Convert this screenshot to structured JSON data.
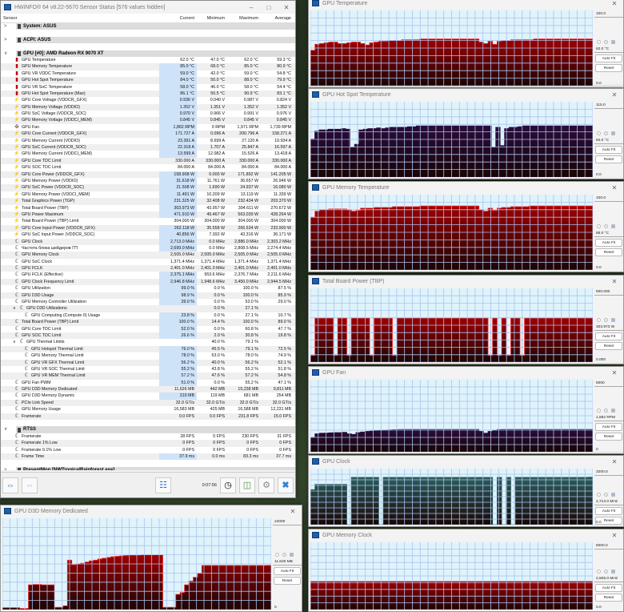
{
  "main": {
    "title": "HWiNFO® 64 v8.22-5670 Sensor Status [576 values hidden]",
    "columns": [
      "Sensor",
      "Current",
      "Minimum",
      "Maximum",
      "Average"
    ],
    "groups": {
      "system": "System: ASUS",
      "acpi": "ACPI: ASUS",
      "gpu": "GPU [#0]: AMD Radeon RX 9070 XT",
      "rtss": "RTSS",
      "presentmon": "PresentMon [NWTropicalRainforest.exe]"
    },
    "gpu_rows": [
      [
        "therm",
        "GPU Temperature",
        "62.0 °C",
        "47.0 °C",
        "62.0 °C",
        "59.3 °C",
        0,
        0
      ],
      [
        "therm",
        "GPU Memory Temperature",
        "85.0 °C",
        "68.0 °C",
        "85.0 °C",
        "80.9 °C",
        1,
        0
      ],
      [
        "therm",
        "GPU VR VDDC Temperature",
        "59.0 °C",
        "42.0 °C",
        "59.0 °C",
        "54.8 °C",
        1,
        0
      ],
      [
        "therm",
        "GPU Hot Spot Temperature",
        "84.0 °C",
        "50.0 °C",
        "88.0 °C",
        "79.9 °C",
        1,
        0
      ],
      [
        "therm",
        "GPU VR SoC Temperature",
        "58.0 °C",
        "46.0 °C",
        "58.0 °C",
        "54.4 °C",
        1,
        0
      ],
      [
        "therm",
        "GPU Hot Spot Temperature (Max)",
        "86.1 °C",
        "50.5 °C",
        "90.9 °C",
        "83.1 °C",
        1,
        0
      ],
      [
        "bolt",
        "GPU Core Voltage (VDDCR_GFX)",
        "0.936 V",
        "0.040 V",
        "0.987 V",
        "0.824 V",
        1,
        0
      ],
      [
        "bolt",
        "GPU Memory Voltage (VDDIO)",
        "1.352 V",
        "1.351 V",
        "1.352 V",
        "1.352 V",
        1,
        0
      ],
      [
        "bolt",
        "GPU SoC Voltage (VDDCR_SOC)",
        "0.970 V",
        "0.966 V",
        "0.991 V",
        "0.976 V",
        1,
        0
      ],
      [
        "bolt",
        "GPU Memory Voltage (VDDCI_MEM)",
        "0.845 V",
        "0.845 V",
        "0.845 V",
        "0.845 V",
        1,
        0
      ],
      [
        "fan",
        "GPU Fan",
        "1,862 RPM",
        "0 RPM",
        "1,971 RPM",
        "1,739 RPM",
        1,
        0
      ],
      [
        "bolt",
        "GPU Core Current (VDDCR_GFX)",
        "171.727 A",
        "0.096 A",
        "200.796 A",
        "158.271 A",
        1,
        0
      ],
      [
        "bolt",
        "GPU Memory Current (VDDIO)",
        "23.391 A",
        "8.699 A",
        "27.120 A",
        "19.934 A",
        1,
        0
      ],
      [
        "bolt",
        "GPU SoC Current (VDDCR_SOC)",
        "22.318 A",
        "1.707 A",
        "25.847 A",
        "16.597 A",
        1,
        0
      ],
      [
        "bolt",
        "GPU Memory Current (VDDCI_MEM)",
        "13.599 A",
        "12.082 A",
        "15.526 A",
        "13.418 A",
        1,
        0
      ],
      [
        "bolt",
        "GPU Core TDC Limit",
        "330.000 A",
        "330.000 A",
        "330.000 A",
        "330.000 A",
        0,
        0
      ],
      [
        "bolt",
        "GPU SOC TDC Limit",
        "84.000 A",
        "84.000 A",
        "84.000 A",
        "84.000 A",
        0,
        0
      ],
      [
        "bolt",
        "GPU Core Power (VDDCR_GFX)",
        "158.908 W",
        "0.000 W",
        "171.892 W",
        "141.205 W",
        1,
        0
      ],
      [
        "bolt",
        "GPU Memory Power (VDDIO)",
        "31.618 W",
        "11.761 W",
        "36.657 W",
        "26.946 W",
        1,
        0
      ],
      [
        "bolt",
        "GPU SoC Power (VDDCR_SOC)",
        "21.508 W",
        "1.690 W",
        "24.937 W",
        "16.080 W",
        1,
        0
      ],
      [
        "bolt",
        "GPU Memory Power (VDDCI_MEM)",
        "11.491 W",
        "10.209 W",
        "13.119 W",
        "11.339 W",
        1,
        0
      ],
      [
        "bolt",
        "Total Graphics Power (TGP)",
        "231.325 W",
        "32.408 W",
        "232.434 W",
        "203.370 W",
        1,
        0
      ],
      [
        "bolt",
        "Total Board Power (TBP)",
        "303.973 W",
        "43.957 W",
        "304.611 W",
        "270.672 W",
        1,
        0
      ],
      [
        "bolt",
        "GPU Power Maximum",
        "471.910 W",
        "49.467 W",
        "563.039 W",
        "428.264 W",
        1,
        0
      ],
      [
        "bolt",
        "Total Board Power (TBP) Limit",
        "304.000 W",
        "304.000 W",
        "304.000 W",
        "304.000 W",
        0,
        0
      ],
      [
        "bolt",
        "GPU Core Input Power (VDDCR_GFX)",
        "262.118 W",
        "35.558 W",
        "266.534 W",
        "233.900 W",
        1,
        0
      ],
      [
        "bolt",
        "GPU SoC Input Power (VDDCR_SOC)",
        "40.856 W",
        "7.392 W",
        "43.316 W",
        "36.171 W",
        1,
        0
      ],
      [
        "clk",
        "GPU Clock",
        "2,713.0 MHz",
        "0.0 MHz",
        "2,886.0 MHz",
        "2,303.2 MHz",
        1,
        0
      ],
      [
        "clk",
        "Частота блока шейдеров ГП",
        "2,699.0 MHz",
        "0.0 MHz",
        "2,808.5 MHz",
        "2,274.4 MHz",
        1,
        0
      ],
      [
        "clk",
        "GPU Memory Clock",
        "2,505.0 MHz",
        "2,505.0 MHz",
        "2,505.0 MHz",
        "2,505.0 MHz",
        0,
        0
      ],
      [
        "clk",
        "GPU SoC Clock",
        "1,371.4 MHz",
        "1,371.4 MHz",
        "1,371.4 MHz",
        "1,371.4 MHz",
        0,
        0
      ],
      [
        "clk",
        "GPU FCLK",
        "2,401.0 MHz",
        "2,401.0 MHz",
        "2,401.0 MHz",
        "2,401.0 MHz",
        0,
        0
      ],
      [
        "clk",
        "GPU FCLK (Effective)",
        "2,375.1 MHz",
        "953.6 MHz",
        "2,376.7 MHz",
        "2,211.6 MHz",
        1,
        0
      ],
      [
        "clk",
        "GPU Clock Frequency Limit",
        "2,946.8 MHz",
        "1,948.6 MHz",
        "3,450.0 MHz",
        "2,944.5 MHz",
        1,
        0
      ],
      [
        "clk",
        "GPU Utilization",
        "99.0 %",
        "0.0 %",
        "100.0 %",
        "87.5 %",
        1,
        0
      ],
      [
        "clk",
        "GPU D3D Usage",
        "98.9 %",
        "0.0 %",
        "100.0 %",
        "85.9 %",
        1,
        0
      ],
      [
        "clk",
        "GPU Memory Controller Utilization",
        "39.0 %",
        "0.0 %",
        "53.0 %",
        "29.0 %",
        1,
        0
      ],
      [
        "clk",
        "GPU D3D Utilizations",
        "",
        "0.0 %",
        "27.1 %",
        "",
        0,
        1
      ],
      [
        "clk",
        "GPU Computing (Compute 0) Usage",
        "23.8 %",
        "0.0 %",
        "27.1 %",
        "10.7 %",
        1,
        2
      ],
      [
        "clk",
        "Total Board Power (TBP) Limit",
        "100.0 %",
        "14.4 %",
        "100.0 %",
        "89.0 %",
        1,
        0
      ],
      [
        "clk",
        "GPU Core TDC Limit",
        "52.0 %",
        "0.0 %",
        "60.8 %",
        "47.7 %",
        1,
        0
      ],
      [
        "clk",
        "GPU SOC TDC Limit",
        "26.6 %",
        "2.0 %",
        "30.8 %",
        "19.8 %",
        1,
        0
      ],
      [
        "clk",
        "GPU Thermal Limits",
        "",
        "40.0 %",
        "79.1 %",
        "",
        0,
        1
      ],
      [
        "clk",
        "GPU Hotspot Thermal Limit",
        "76.0 %",
        "45.5 %",
        "79.1 %",
        "72.5 %",
        1,
        2
      ],
      [
        "clk",
        "GPU Memory Thermal Limit",
        "78.0 %",
        "63.0 %",
        "78.0 %",
        "74.9 %",
        1,
        2
      ],
      [
        "clk",
        "GPU VR GFX Thermal Limit",
        "56.2 %",
        "40.0 %",
        "56.2 %",
        "52.1 %",
        1,
        2
      ],
      [
        "clk",
        "GPU VR SOC Thermal Limit",
        "55.2 %",
        "43.8 %",
        "55.2 %",
        "51.8 %",
        1,
        2
      ],
      [
        "clk",
        "GPU VR MEM Thermal Limit",
        "57.2 %",
        "47.6 %",
        "57.2 %",
        "54.8 %",
        1,
        2
      ],
      [
        "clk",
        "GPU Fan PWM",
        "51.0 %",
        "0.0 %",
        "55.2 %",
        "47.1 %",
        1,
        0
      ],
      [
        "clk",
        "GPU D3D Memory Dedicated",
        "11,626 MB",
        "442 MB",
        "15,238 MB",
        "9,811 MB",
        0,
        0
      ],
      [
        "clk",
        "GPU D3D Memory Dynamic",
        "210 MB",
        "119 MB",
        "681 MB",
        "254 MB",
        1,
        0
      ],
      [
        "clk",
        "PCIe Link Speed",
        "32.0 GT/s",
        "32.0 GT/s",
        "32.0 GT/s",
        "32.0 GT/s",
        0,
        0
      ],
      [
        "clk",
        "GPU Memory Usage",
        "16,583 MB",
        "425 MB",
        "16,588 MB",
        "12,231 MB",
        0,
        0
      ],
      [
        "clk",
        "Framerate",
        "0.0 FPS",
        "0.0 FPS",
        "231.8 FPS",
        "15.0 FPS",
        0,
        0
      ]
    ],
    "rtss_rows": [
      [
        "clk",
        "Framerate",
        "28 FPS",
        "0 FPS",
        "230 FPS",
        "31 FPS",
        0,
        0
      ],
      [
        "clk",
        "Framerate 1% Low",
        "0 FPS",
        "0 FPS",
        "0 FPS",
        "0 FPS",
        0,
        0
      ],
      [
        "clk",
        "Framerate 0.1% Low",
        "0 FPS",
        "0 FPS",
        "0 FPS",
        "0 FPS",
        0,
        0
      ],
      [
        "clk",
        "Frame Time",
        "37.9 ms",
        "0.0 ms",
        "83.3 ms",
        "37.7 ms",
        1,
        0
      ]
    ],
    "timer": "0:07:56"
  },
  "graph_buttons": {
    "autofit": "Auto Fit",
    "reset": "Reset"
  },
  "graphs": [
    {
      "title": "GPU Temperature",
      "max": "100.0",
      "current": "62.0 °C",
      "min": "0.0",
      "scale": 100,
      "color": "#a00000",
      "values": [
        47,
        55,
        56,
        57,
        58,
        58,
        56,
        56,
        57,
        58,
        58,
        56,
        54,
        57,
        58,
        59,
        59,
        60,
        60,
        60,
        61,
        61,
        61,
        61,
        62,
        62,
        62,
        62,
        62,
        62,
        62,
        62,
        62,
        62,
        62,
        62,
        62,
        58,
        56,
        59,
        55,
        59,
        60,
        60,
        61,
        61,
        61,
        61,
        61,
        62,
        62,
        62,
        62,
        62,
        62,
        62,
        62,
        62,
        62,
        62,
        62,
        62
      ]
    },
    {
      "title": "GPU Hot Spot Temperature",
      "max": "115.0",
      "current": "84.0 °C",
      "min": "0.0",
      "scale": 115,
      "color": "#2a0c3a",
      "values": [
        58,
        70,
        72,
        72,
        73,
        73,
        73,
        74,
        73,
        45,
        50,
        72,
        73,
        74,
        74,
        75,
        74,
        75,
        76,
        76,
        76,
        76,
        77,
        77,
        78,
        78,
        78,
        78,
        78,
        78,
        78,
        78,
        78,
        78,
        78,
        78,
        78,
        78,
        78,
        78,
        78,
        45,
        76,
        48,
        74,
        76,
        76,
        77,
        78,
        78,
        78,
        78,
        78,
        78,
        78,
        78,
        78,
        78,
        78,
        78,
        78,
        78,
        78,
        78
      ]
    },
    {
      "title": "GPU Memory Temperature",
      "max": "100.0",
      "current": "85.0 °C",
      "min": "0.0",
      "scale": 100,
      "color": "#a00000",
      "values": [
        70,
        78,
        80,
        80,
        81,
        81,
        81,
        81,
        80,
        78,
        79,
        82,
        82,
        82,
        83,
        83,
        83,
        83,
        84,
        84,
        84,
        84,
        84,
        84,
        85,
        85,
        85,
        85,
        85,
        85,
        85,
        85,
        85,
        85,
        85,
        85,
        85,
        80,
        78,
        82,
        79,
        82,
        83,
        83,
        84,
        84,
        84,
        84,
        85,
        85,
        85,
        85,
        85,
        85,
        85,
        85,
        85,
        85,
        85,
        85,
        85,
        85
      ]
    },
    {
      "title": "Total Board Power (TBP)",
      "max": "500.000",
      "current": "303.973 W",
      "min": "0.000",
      "scale": 500,
      "color": "#a00000",
      "values": [
        45,
        300,
        300,
        300,
        300,
        45,
        300,
        300,
        45,
        300,
        300,
        300,
        300,
        45,
        300,
        300,
        300,
        300,
        45,
        300,
        300,
        300,
        300,
        300,
        300,
        300,
        300,
        300,
        300,
        300,
        300,
        300,
        300,
        300,
        300,
        300,
        300,
        300,
        300,
        45,
        300,
        45,
        300,
        45,
        300,
        300,
        45,
        300,
        300,
        300,
        300,
        300,
        300,
        300,
        300,
        300,
        300,
        300,
        300,
        300,
        300,
        300
      ]
    },
    {
      "title": "GPU Fan",
      "max": "6000",
      "current": "1,862 RPM",
      "min": "0",
      "scale": 6000,
      "color": "#2a0c3a",
      "values": [
        1200,
        1500,
        1550,
        1560,
        1580,
        1600,
        1600,
        1620,
        1500,
        1450,
        1600,
        1650,
        1700,
        1720,
        1750,
        1780,
        1800,
        1820,
        1840,
        1850,
        1860,
        1860,
        1860,
        1860,
        1860,
        1860,
        1860,
        1860,
        1860,
        1860,
        1860,
        1860,
        1860,
        1860,
        1860,
        1860,
        1860,
        1700,
        1550,
        1700,
        1800,
        1850,
        1860,
        1860,
        1860,
        1860,
        1860,
        1860,
        1860,
        1860,
        1860,
        1860,
        1860,
        1860,
        1860,
        1860,
        1860,
        1860,
        1860,
        1860,
        1860,
        1862
      ]
    },
    {
      "title": "GPU Clock",
      "max": "3200.0",
      "current": "2,713.0 MHz",
      "min": "0.0",
      "scale": 3200,
      "color": "#2c5e5c",
      "values": [
        2000,
        2300,
        2300,
        2300,
        2300,
        2300,
        2300,
        2300,
        0,
        2700,
        2700,
        2700,
        2700,
        2700,
        2700,
        0,
        2700,
        2700,
        2700,
        2700,
        2700,
        2700,
        2700,
        2700,
        2700,
        2700,
        2700,
        2700,
        2700,
        2700,
        2700,
        2700,
        2700,
        2700,
        2700,
        2700,
        2700,
        2700,
        2700,
        2700,
        0,
        2700,
        0,
        2700,
        0,
        2700,
        2700,
        2700,
        2700,
        2700,
        2700,
        2700,
        2700,
        2700,
        2700,
        2700,
        2700,
        2700,
        2700,
        2700,
        2700,
        2713
      ]
    },
    {
      "title": "GPU Memory Clock",
      "max": "6000.0",
      "current": "2,505.0 MHz",
      "min": "0.0",
      "scale": 6000,
      "color": "#a00000",
      "values": [
        2505,
        2505,
        2505,
        2505,
        2505,
        2505,
        2505,
        2505,
        2505,
        2505
      ]
    },
    {
      "title": "GPU D3D Memory Dedicated",
      "max": "24000",
      "current": "11,626 MB",
      "min": "0",
      "scale": 24000,
      "color": "#a00000",
      "values": [
        500,
        500,
        500,
        500,
        300,
        300,
        6500,
        6600,
        6600,
        6500,
        6500,
        6500,
        600,
        600,
        1000,
        13000,
        11800,
        12000,
        12200,
        12500,
        12800,
        13000,
        13300,
        13500,
        13700,
        13900,
        14000,
        14100,
        14200,
        14300,
        14300,
        14300,
        14400,
        14400,
        14400,
        14400,
        14400,
        600,
        600,
        600,
        4000,
        4500,
        6500,
        7500,
        8500,
        9500,
        11600,
        11600,
        11600,
        11600,
        11600,
        11600,
        11600,
        11600,
        11600,
        11600,
        11600,
        11600,
        11600,
        11600,
        11600,
        11626
      ]
    }
  ]
}
